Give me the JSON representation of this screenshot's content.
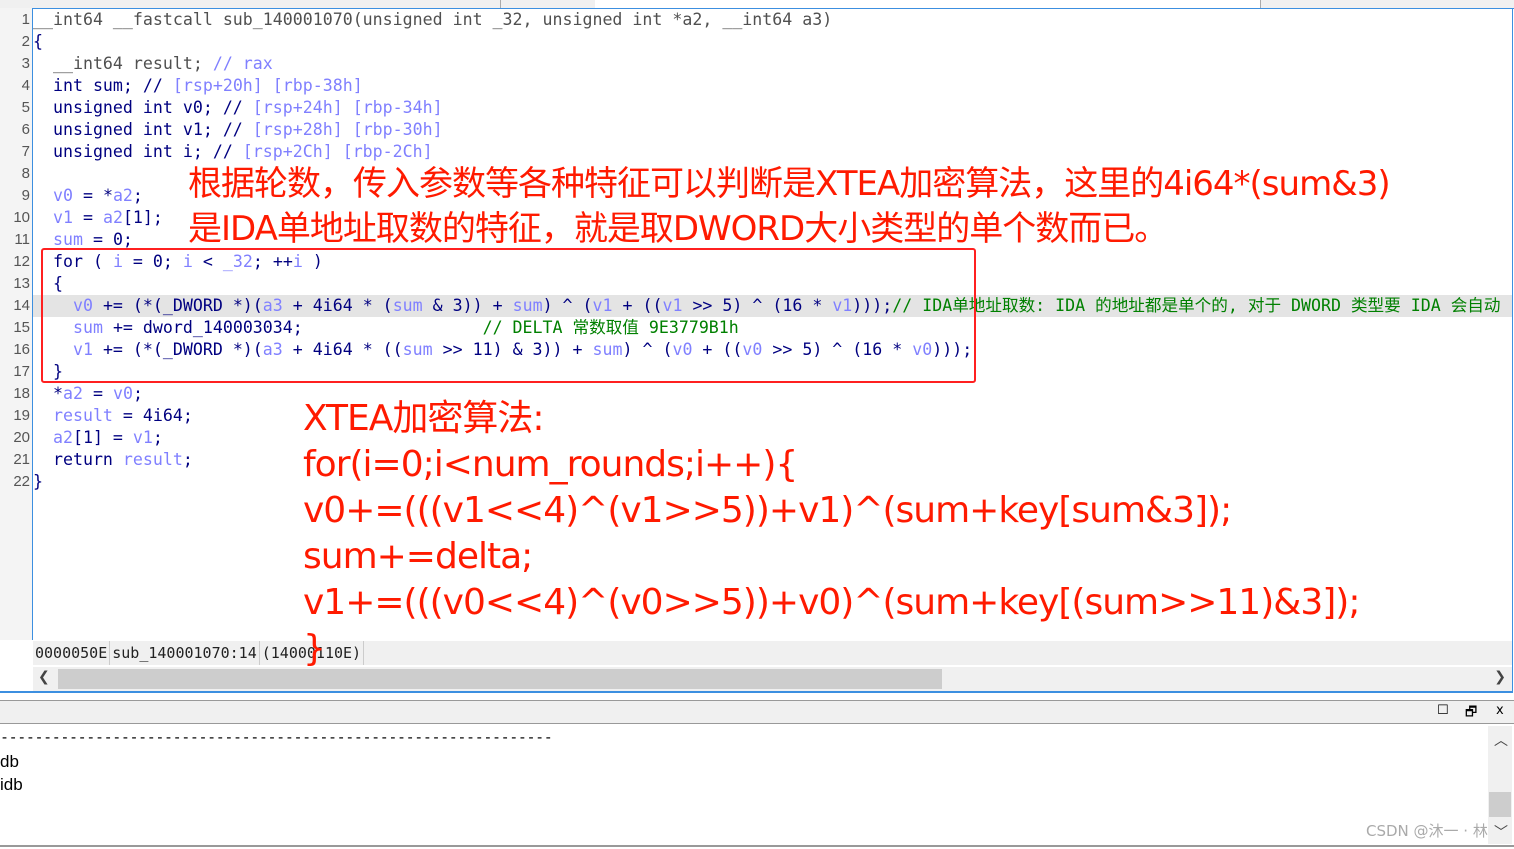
{
  "code_lines": [
    [
      [
        "__int64 __fastcall sub_140001070(unsigned int _32, unsigned int *a2, __int64 a3)",
        "g"
      ]
    ],
    [
      [
        "{",
        "k"
      ]
    ],
    [
      [
        "  __int64 result; ",
        "g"
      ],
      [
        "// rax",
        "v"
      ]
    ],
    [
      [
        "  int sum; // ",
        "k"
      ],
      [
        "[rsp+20h] [rbp-38h]",
        "v"
      ]
    ],
    [
      [
        "  unsigned int v0; // ",
        "k"
      ],
      [
        "[rsp+24h] [rbp-34h]",
        "v"
      ]
    ],
    [
      [
        "  unsigned int v1; // ",
        "k"
      ],
      [
        "[rsp+28h] [rbp-30h]",
        "v"
      ]
    ],
    [
      [
        "  unsigned int i; // ",
        "k"
      ],
      [
        "[rsp+2Ch] [rbp-2Ch]",
        "v"
      ]
    ],
    [
      [
        "",
        "k"
      ]
    ],
    [
      [
        "  ",
        "k"
      ],
      [
        "v0",
        "v"
      ],
      [
        " = *",
        "k"
      ],
      [
        "a2",
        "v"
      ],
      [
        ";",
        "k"
      ]
    ],
    [
      [
        "  ",
        "k"
      ],
      [
        "v1",
        "v"
      ],
      [
        " = ",
        "k"
      ],
      [
        "a2",
        "v"
      ],
      [
        "[1];",
        "k"
      ]
    ],
    [
      [
        "  ",
        "k"
      ],
      [
        "sum",
        "v"
      ],
      [
        " = 0;",
        "k"
      ]
    ],
    [
      [
        "  for ( ",
        "k"
      ],
      [
        "i",
        "v"
      ],
      [
        " = 0; ",
        "k"
      ],
      [
        "i",
        "v"
      ],
      [
        " < ",
        "k"
      ],
      [
        "_32",
        "v"
      ],
      [
        "; ++",
        "k"
      ],
      [
        "i",
        "v"
      ],
      [
        " )",
        "k"
      ]
    ],
    [
      [
        "  {",
        "k"
      ]
    ],
    [
      [
        "    ",
        "k"
      ],
      [
        "v0",
        "v"
      ],
      [
        " += (*(_DWORD *)(",
        "k"
      ],
      [
        "a3",
        "v"
      ],
      [
        " + 4i64 * (",
        "k"
      ],
      [
        "sum",
        "v"
      ],
      [
        " & 3)) + ",
        "k"
      ],
      [
        "sum",
        "v"
      ],
      [
        ") ^ (",
        "k"
      ],
      [
        "v1",
        "v"
      ],
      [
        " + ((",
        "k"
      ],
      [
        "v1",
        "v"
      ],
      [
        " >> 5) ^ (16 * ",
        "k"
      ],
      [
        "v1",
        "v"
      ],
      [
        ")));",
        "k"
      ],
      [
        "// IDA单地址取数: IDA 的地址都是单个的, 对于 DWORD 类型要 IDA 会自动",
        "c"
      ]
    ],
    [
      [
        "    ",
        "k"
      ],
      [
        "sum",
        "v"
      ],
      [
        " += dword_140003034;",
        "k"
      ],
      [
        "                  // DELTA 常数取值 9E3779B1h",
        "c"
      ]
    ],
    [
      [
        "    ",
        "k"
      ],
      [
        "v1",
        "v"
      ],
      [
        " += (*(_DWORD *)(",
        "k"
      ],
      [
        "a3",
        "v"
      ],
      [
        " + 4i64 * ((",
        "k"
      ],
      [
        "sum",
        "v"
      ],
      [
        " >> 11) & 3)) + ",
        "k"
      ],
      [
        "sum",
        "v"
      ],
      [
        ") ^ (",
        "k"
      ],
      [
        "v0",
        "v"
      ],
      [
        " + ((",
        "k"
      ],
      [
        "v0",
        "v"
      ],
      [
        " >> 5) ^ (16 * ",
        "k"
      ],
      [
        "v0",
        "v"
      ],
      [
        ")));",
        "k"
      ]
    ],
    [
      [
        "  }",
        "k"
      ]
    ],
    [
      [
        "  *",
        "k"
      ],
      [
        "a2",
        "v"
      ],
      [
        " = ",
        "k"
      ],
      [
        "v0",
        "v"
      ],
      [
        ";",
        "k"
      ]
    ],
    [
      [
        "  ",
        "k"
      ],
      [
        "result",
        "v"
      ],
      [
        " = 4i64;",
        "k"
      ]
    ],
    [
      [
        "  ",
        "k"
      ],
      [
        "a2",
        "v"
      ],
      [
        "[1] = ",
        "k"
      ],
      [
        "v1",
        "v"
      ],
      [
        ";",
        "k"
      ]
    ],
    [
      [
        "  return ",
        "k"
      ],
      [
        "result",
        "v"
      ],
      [
        ";",
        "k"
      ]
    ],
    [
      [
        "}",
        "k"
      ]
    ]
  ],
  "highlighted_line": 14,
  "status": {
    "offset": "0000050E",
    "location": "sub_140001070:14",
    "address": "(14000110E)"
  },
  "annotations": {
    "top": "根据轮数，传入参数等各种特征可以判断是XTEA加密算法，这里的4i64*(sum&3)\n是IDA单地址取数的特征，就是取DWORD大小类型的单个数而已。",
    "xtea": "XTEA加密算法:\nfor(i=0;i<num_rounds;i++){\nv0+=(((v1<<4)^(v1>>5))+v1)^(sum+key[sum&3]);\nsum+=delta;\nv1+=(((v0<<4)^(v0>>5))+v0)^(sum+key[(sum>>11)&3]);\n}"
  },
  "output": {
    "dashes": "----------------------------------------------------------------",
    "lines": [
      "db",
      "idb"
    ]
  },
  "panel_buttons": {
    "maximize": "☐",
    "restore": "🗗",
    "close": "x"
  },
  "watermark": "CSDN @沐一 · 林",
  "colors": {
    "annotation": "#ff1a00",
    "accent": "#3c8fe0",
    "comment": "#008000",
    "variable": "#8080ff",
    "keyword": "#000080"
  }
}
